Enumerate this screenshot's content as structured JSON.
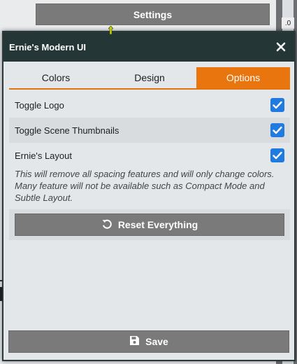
{
  "background": {
    "settings_label": "Settings",
    "right_tag": ".0"
  },
  "dialog": {
    "title": "Ernie's Modern UI",
    "close_icon": "close-icon"
  },
  "tabs": [
    {
      "label": "Colors",
      "active": false
    },
    {
      "label": "Design",
      "active": false
    },
    {
      "label": "Options",
      "active": true
    }
  ],
  "options": {
    "items": [
      {
        "label": "Toggle Logo",
        "checked": true
      },
      {
        "label": "Toggle Scene Thumbnails",
        "checked": true
      },
      {
        "label": "Ernie's Layout",
        "checked": true
      }
    ],
    "note": "This will remove all spacing features and will only change colors. Many feature will not be available such as Compact Mode and Subtle Layout."
  },
  "reset": {
    "label": "Reset Everything",
    "icon": "undo-icon"
  },
  "save": {
    "label": "Save",
    "icon": "floppy-disk-icon"
  },
  "colors": {
    "accent": "#e8750d",
    "header": "#243636",
    "checkbox": "#1f7be0",
    "button": "#7a7a7a"
  }
}
